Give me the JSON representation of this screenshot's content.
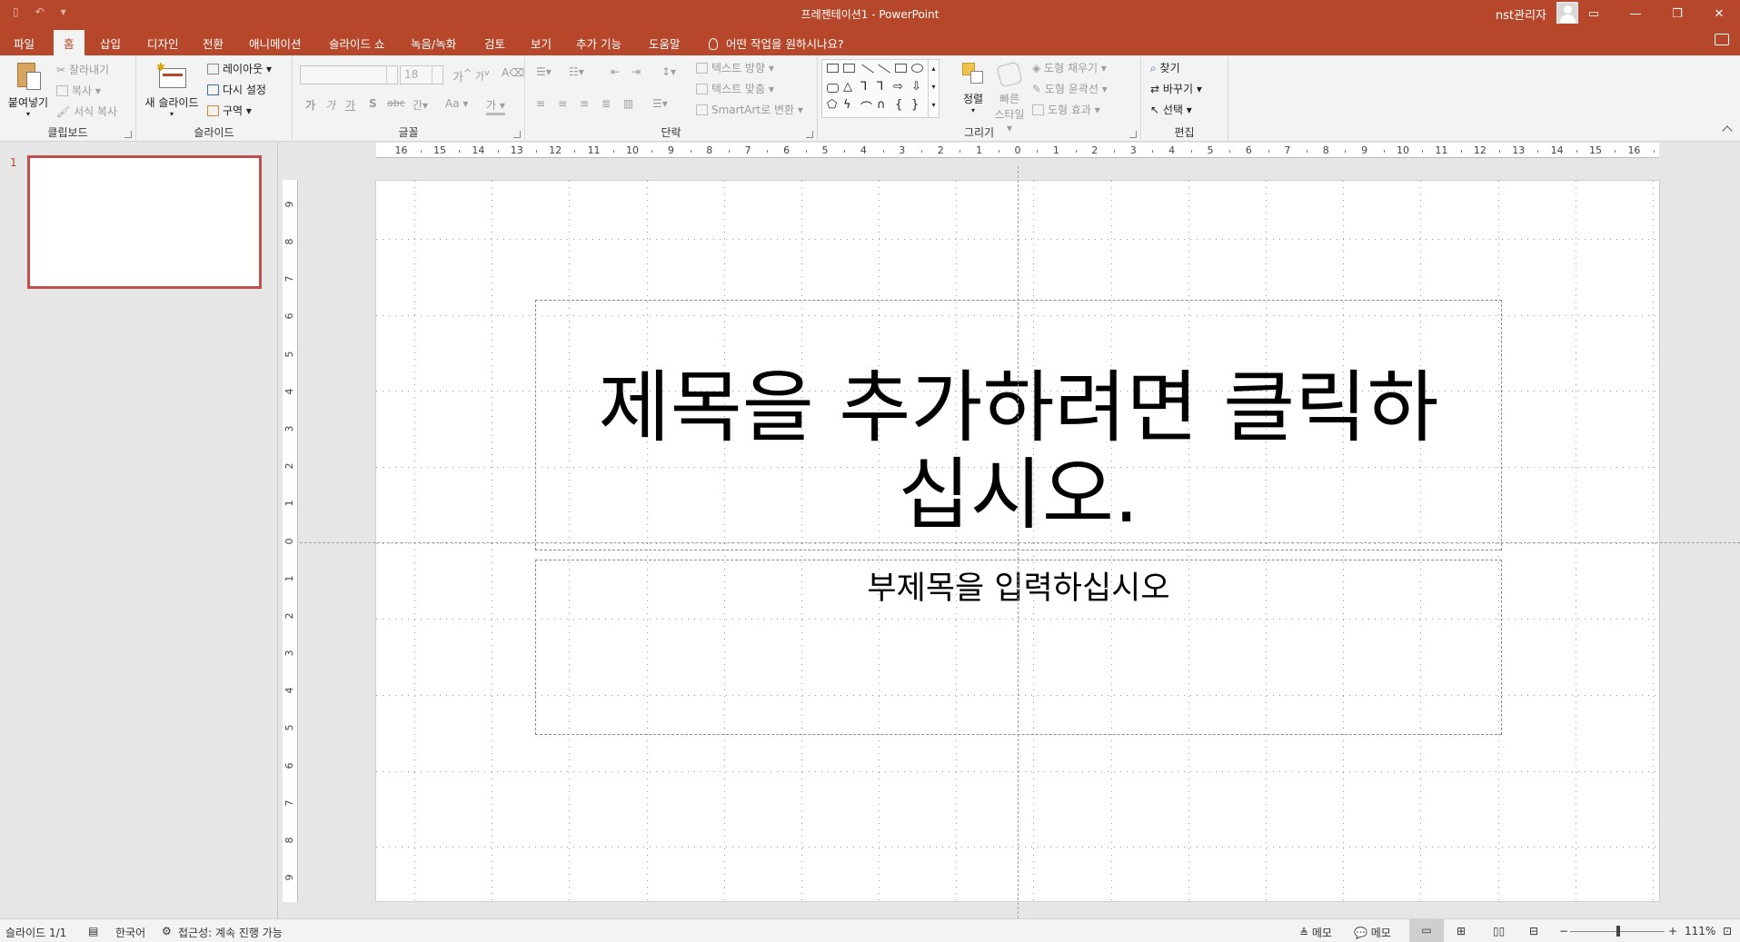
{
  "window": {
    "title": "프레젠테이션1  -  PowerPoint",
    "user": "nst관리자",
    "controls": [
      "minimize",
      "maximize",
      "close"
    ]
  },
  "quick_access": [
    "save-icon",
    "undo-icon",
    "customize-icon"
  ],
  "tabs": [
    "파일",
    "홈",
    "삽입",
    "디자인",
    "전환",
    "애니메이션",
    "슬라이드 쇼",
    "녹음/녹화",
    "검토",
    "보기",
    "추가 기능",
    "도움말"
  ],
  "active_tab": "홈",
  "tellme": "어떤 작업을 원하시나요?",
  "ribbon": {
    "clipboard": {
      "label": "클립보드",
      "paste": "붙여넣기",
      "cut": "잘라내기",
      "copy": "복사",
      "format_painter": "서식 복사"
    },
    "slides": {
      "label": "슬라이드",
      "new_slide": "새 슬라이드",
      "layout": "레이아웃",
      "reset": "다시 설정",
      "section": "구역"
    },
    "font": {
      "label": "글꼴",
      "font_name": "",
      "font_size": "18",
      "size_up": "가",
      "size_down": "가",
      "bold": "가",
      "italic": "가",
      "underline": "가",
      "shadow": "S",
      "strike": "abc",
      "spacing": "간",
      "case": "Aa",
      "color": "가"
    },
    "paragraph": {
      "label": "단락",
      "text_direction": "텍스트 방향",
      "align_text": "텍스트 맞춤",
      "smartart": "SmartArt로 변환"
    },
    "drawing": {
      "label": "그리기",
      "arrange": "정렬",
      "quick_styles_line1": "빠른",
      "quick_styles_line2": "스타일",
      "shape_fill": "도형 채우기",
      "shape_outline": "도형 윤곽선",
      "shape_effects": "도형 효과"
    },
    "editing": {
      "label": "편집",
      "find": "찾기",
      "replace": "바꾸기",
      "select": "선택"
    }
  },
  "slides_pane": {
    "slide_number": "1"
  },
  "rulers": {
    "horizontal": [
      "16",
      "15",
      "14",
      "13",
      "12",
      "11",
      "10",
      "9",
      "8",
      "7",
      "6",
      "5",
      "4",
      "3",
      "2",
      "1",
      "0",
      "1",
      "2",
      "3",
      "4",
      "5",
      "6",
      "7",
      "8",
      "9",
      "10",
      "11",
      "12",
      "13",
      "14",
      "15",
      "16"
    ],
    "vertical": [
      "9",
      "8",
      "7",
      "6",
      "5",
      "4",
      "3",
      "2",
      "1",
      "0",
      "1",
      "2",
      "3",
      "4",
      "5",
      "6",
      "7",
      "8",
      "9"
    ]
  },
  "slide": {
    "title_placeholder": "제목을 추가하려면 클릭하\n십시오.",
    "subtitle_placeholder": "부제목을 입력하십시오"
  },
  "status": {
    "slide_info": "슬라이드 1/1",
    "language": "한국어",
    "accessibility": "접근성: 계속 진행 가능",
    "notes": "메모",
    "comments": "메모",
    "zoom": "111%"
  },
  "colors": {
    "accent": "#b7472a",
    "thumb_border": "#c0504d"
  }
}
